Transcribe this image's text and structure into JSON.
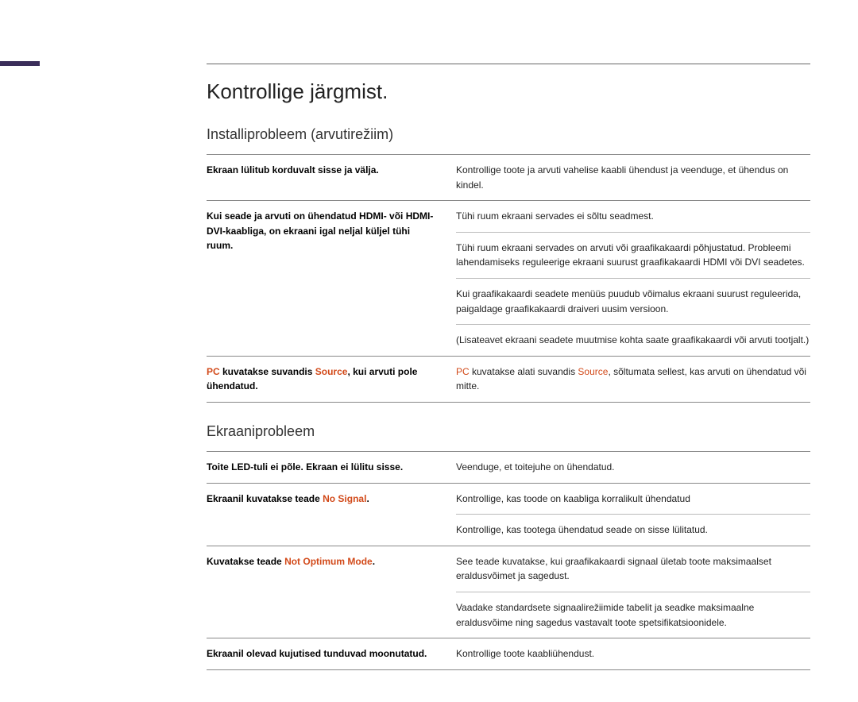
{
  "heading": "Kontrollige järgmist.",
  "sections": [
    {
      "title": "Installiprobleem (arvutirežiim)",
      "rows": [
        {
          "left_parts": [
            {
              "text": "Ekraan lülitub korduvalt sisse ja välja.",
              "hl": false
            }
          ],
          "right": [
            {
              "text": "Kontrollige toote ja arvuti vahelise kaabli ühendust ja veenduge, et ühendus on kindel."
            }
          ]
        },
        {
          "left_parts": [
            {
              "text": "Kui seade ja arvuti on ühendatud HDMI- või HDMI-DVI-kaabliga, on ekraani igal neljal küljel tühi ruum.",
              "hl": false
            }
          ],
          "right": [
            {
              "text": "Tühi ruum ekraani servades ei sõltu seadmest."
            },
            {
              "text": "Tühi ruum ekraani servades on arvuti või graafikakaardi põhjustatud. Probleemi lahendamiseks reguleerige ekraani suurust graafikakaardi HDMI või DVI seadetes."
            },
            {
              "text": "Kui graafikakaardi seadete menüüs puudub võimalus ekraani suurust reguleerida, paigaldage graafikakaardi draiveri uusim versioon."
            },
            {
              "text": "(Lisateavet ekraani seadete muutmise kohta saate graafikakaardi või arvuti tootjalt.)"
            }
          ]
        },
        {
          "left_parts": [
            {
              "text": "PC",
              "hl": true
            },
            {
              "text": " kuvatakse suvandis ",
              "hl": false
            },
            {
              "text": "Source",
              "hl": true
            },
            {
              "text": ", kui arvuti pole ühendatud.",
              "hl": false
            }
          ],
          "right_parts": [
            {
              "text": "PC",
              "hl": true
            },
            {
              "text": " kuvatakse alati suvandis ",
              "hl": false
            },
            {
              "text": "Source",
              "hl": true
            },
            {
              "text": ", sõltumata sellest, kas arvuti on ühendatud või mitte.",
              "hl": false
            }
          ]
        }
      ]
    },
    {
      "title": "Ekraaniprobleem",
      "rows": [
        {
          "left_parts": [
            {
              "text": "Toite LED-tuli ei põle. Ekraan ei lülitu sisse.",
              "hl": false
            }
          ],
          "right": [
            {
              "text": "Veenduge, et toitejuhe on ühendatud."
            }
          ]
        },
        {
          "left_parts": [
            {
              "text": "Ekraanil kuvatakse teade ",
              "hl": false
            },
            {
              "text": "No Signal",
              "hl": true
            },
            {
              "text": ".",
              "hl": false
            }
          ],
          "right": [
            {
              "text": "Kontrollige, kas toode on kaabliga korralikult ühendatud"
            },
            {
              "text": "Kontrollige, kas tootega ühendatud seade on sisse lülitatud."
            }
          ]
        },
        {
          "left_parts": [
            {
              "text": "Kuvatakse teade ",
              "hl": false
            },
            {
              "text": "Not Optimum Mode",
              "hl": true
            },
            {
              "text": ".",
              "hl": false
            }
          ],
          "right": [
            {
              "text": "See teade kuvatakse, kui graafikakaardi signaal ületab toote maksimaalset eraldusvõimet ja sagedust."
            },
            {
              "text": "Vaadake standardsete signaalirežiimide tabelit ja seadke maksimaalne eraldusvõime ning sagedus vastavalt toote spetsifikatsioonidele."
            }
          ]
        },
        {
          "left_parts": [
            {
              "text": "Ekraanil olevad kujutised tunduvad moonutatud.",
              "hl": false
            }
          ],
          "right": [
            {
              "text": "Kontrollige toote kaabliühendust."
            }
          ]
        }
      ]
    }
  ]
}
